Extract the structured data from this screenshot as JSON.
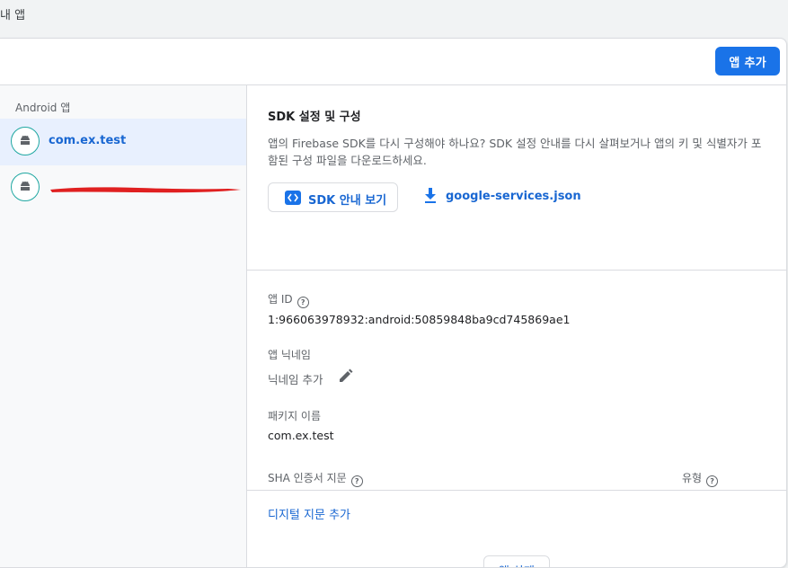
{
  "page": {
    "section_title": "내 앱"
  },
  "header": {
    "add_app_label": "앱 추가"
  },
  "sidebar": {
    "group_label": "Android 앱",
    "items": [
      {
        "label": "com.ex.test",
        "selected": true,
        "icon": "android-icon"
      },
      {
        "label": "",
        "redacted": true,
        "icon": "android-icon"
      }
    ]
  },
  "sdk": {
    "title": "SDK 설정 및 구성",
    "description": "앱의 Firebase SDK를 다시 구성해야 하나요? SDK 설정 안내를 다시 살펴보거나 앱의 키 및 식별자가 포함된 구성 파일을 다운로드하세요.",
    "guide_button_label": "SDK 안내 보기",
    "download_label": "google-services.json"
  },
  "details": {
    "app_id_label": "앱 ID",
    "app_id_value": "1:966063978932:android:50859848ba9cd745869ae1",
    "nickname_label": "앱 닉네임",
    "nickname_value": "닉네임 추가",
    "package_label": "패키지 이름",
    "package_value": "com.ex.test",
    "sha_label": "SHA 인증서 지문",
    "type_label": "유형",
    "help_glyph": "?",
    "add_fingerprint_label": "디지털 지문 추가",
    "delete_label": "앱 삭제"
  },
  "colors": {
    "primary": "#1a73e8",
    "link": "#1967d2",
    "selected_bg": "#e8f0fe",
    "android_ring": "#1ea7a1",
    "redaction": "#e02020"
  }
}
